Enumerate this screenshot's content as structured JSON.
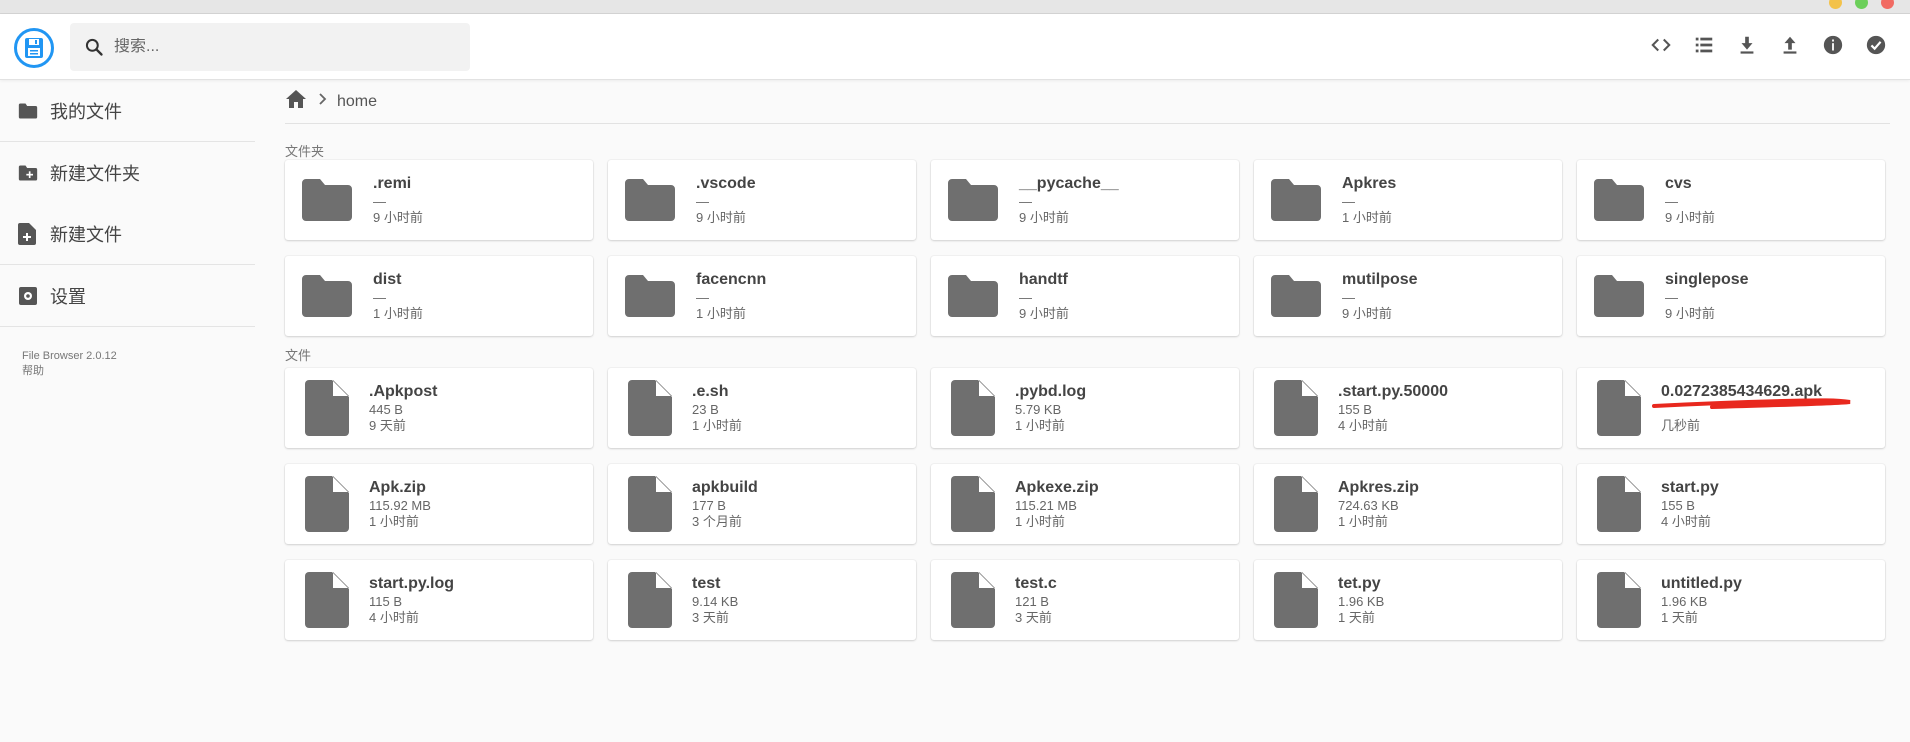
{
  "window": {
    "title": ""
  },
  "header": {
    "search_placeholder": "搜索...",
    "actions": [
      {
        "name": "code-view-icon"
      },
      {
        "name": "list-view-icon"
      },
      {
        "name": "download-icon"
      },
      {
        "name": "upload-icon"
      },
      {
        "name": "info-icon"
      },
      {
        "name": "select-check-icon"
      }
    ]
  },
  "sidebar": {
    "items": [
      {
        "label": "我的文件",
        "icon": "folder-icon"
      },
      {
        "label": "新建文件夹",
        "icon": "new-folder-icon"
      },
      {
        "label": "新建文件",
        "icon": "new-file-icon"
      },
      {
        "label": "设置",
        "icon": "settings-icon"
      }
    ],
    "footer": {
      "version": "File Browser 2.0.12",
      "help": "帮助"
    }
  },
  "breadcrumb": {
    "path": "home"
  },
  "sections": {
    "folders": "文件夹",
    "files": "文件"
  },
  "folders": [
    {
      "name": ".remi",
      "size": "—",
      "time": "9 小时前"
    },
    {
      "name": ".vscode",
      "size": "—",
      "time": "9 小时前"
    },
    {
      "name": "__pycache__",
      "size": "—",
      "time": "9 小时前"
    },
    {
      "name": "Apkres",
      "size": "—",
      "time": "1 小时前"
    },
    {
      "name": "cvs",
      "size": "—",
      "time": "9 小时前"
    },
    {
      "name": "dist",
      "size": "—",
      "time": "1 小时前"
    },
    {
      "name": "facencnn",
      "size": "—",
      "time": "1 小时前"
    },
    {
      "name": "handtf",
      "size": "—",
      "time": "9 小时前"
    },
    {
      "name": "mutilpose",
      "size": "—",
      "time": "9 小时前"
    },
    {
      "name": "singlepose",
      "size": "—",
      "time": "9 小时前"
    }
  ],
  "files": [
    {
      "name": ".Apkpost",
      "size": "445 B",
      "time": "9 天前"
    },
    {
      "name": ".e.sh",
      "size": "23 B",
      "time": "1 小时前"
    },
    {
      "name": ".pybd.log",
      "size": "5.79 KB",
      "time": "1 小时前"
    },
    {
      "name": ".start.py.50000",
      "size": "155 B",
      "time": "4 小时前"
    },
    {
      "name": "0.0272385434629.apk",
      "size": "",
      "time": "几秒前"
    },
    {
      "name": "Apk.zip",
      "size": "115.92 MB",
      "time": "1 小时前"
    },
    {
      "name": "apkbuild",
      "size": "177 B",
      "time": "3 个月前"
    },
    {
      "name": "Apkexe.zip",
      "size": "115.21 MB",
      "time": "1 小时前"
    },
    {
      "name": "Apkres.zip",
      "size": "724.63 KB",
      "time": "1 小时前"
    },
    {
      "name": "start.py",
      "size": "155 B",
      "time": "4 小时前"
    },
    {
      "name": "start.py.log",
      "size": "115 B",
      "time": "4 小时前"
    },
    {
      "name": "test",
      "size": "9.14 KB",
      "time": "3 天前"
    },
    {
      "name": "test.c",
      "size": "121 B",
      "time": "3 天前"
    },
    {
      "name": "tet.py",
      "size": "1.96 KB",
      "time": "1 天前"
    },
    {
      "name": "untitled.py",
      "size": "1.96 KB",
      "time": "1 天前"
    }
  ],
  "colors": {
    "accent": "#2196f3",
    "icon": "#6f6f6f",
    "annotation": "#e8281e"
  }
}
